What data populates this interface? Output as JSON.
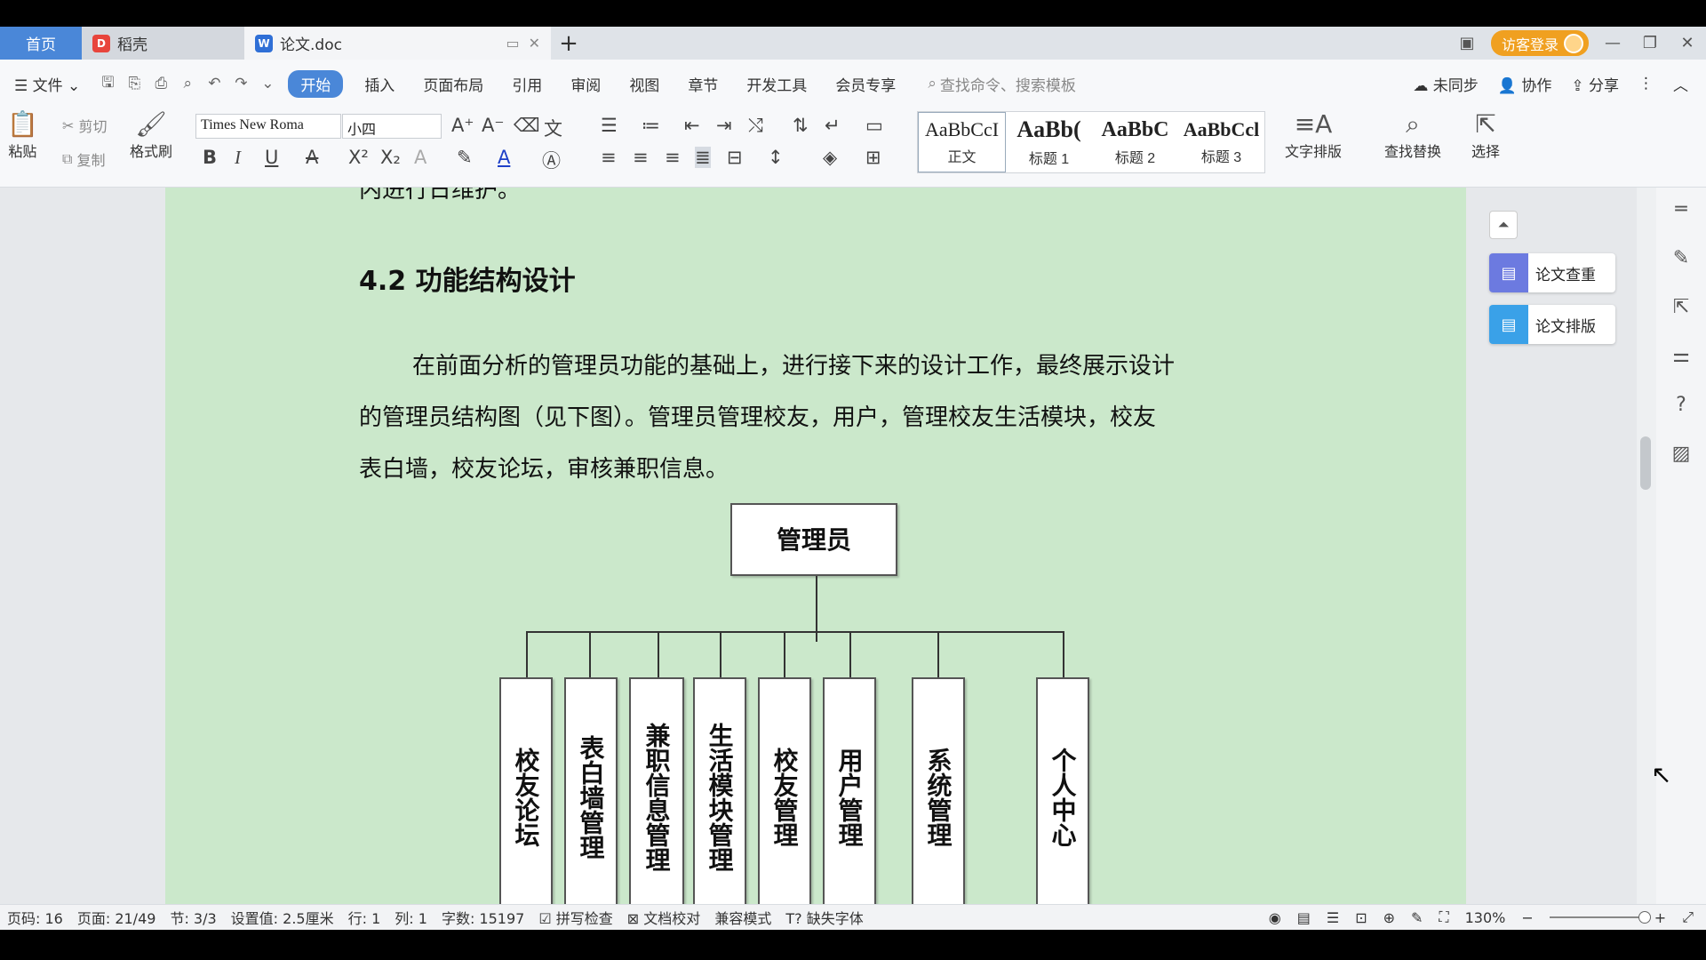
{
  "tabs": {
    "home": "首页",
    "straw": "稻壳",
    "doc": "论文.doc",
    "add": "+"
  },
  "titlebar": {
    "login": "访客登录"
  },
  "menu": {
    "file": "文件",
    "items": [
      "开始",
      "插入",
      "页面布局",
      "引用",
      "审阅",
      "视图",
      "章节",
      "开发工具",
      "会员专享"
    ],
    "search_placeholder": "查找命令、搜索模板",
    "unsynced": "未同步",
    "collab": "协作",
    "share": "分享"
  },
  "ribbon": {
    "paste": "粘贴",
    "cut": "剪切",
    "copy": "复制",
    "format_painter": "格式刷",
    "font_name": "Times New Roma",
    "font_size": "小四",
    "styles": [
      {
        "preview": "AaBbCcI",
        "name": "正文"
      },
      {
        "preview": "AaBb(",
        "name": "标题 1"
      },
      {
        "preview": "AaBbC",
        "name": "标题 2"
      },
      {
        "preview": "AaBbCcl",
        "name": "标题 3"
      }
    ],
    "text_layout": "文字排版",
    "find_replace": "查找替换",
    "select": "选择"
  },
  "document": {
    "partial_top": "内进行日维护。",
    "heading": "4.2  功能结构设计",
    "para_line1": "在前面分析的管理员功能的基础上，进行接下来的设计工作，最终展示设计",
    "para_line2": "的管理员结构图（见下图）。管理员管理校友，用户，管理校友生活模块，校友",
    "para_line3": "表白墙，校友论坛，审核兼职信息。",
    "diagram": {
      "root": "管理员",
      "children": [
        "校友论坛",
        "表白墙管理",
        "兼职信息管理",
        "生活模块管理",
        "校友管理",
        "用户管理",
        "系统管理",
        "个人中心"
      ]
    }
  },
  "right_panel": {
    "paper_check": "论文查重",
    "paper_format": "论文排版"
  },
  "status": {
    "page_code": "页码: 16",
    "page": "页面: 21/49",
    "section": "节: 3/3",
    "setting": "设置值: 2.5厘米",
    "row": "行: 1",
    "col": "列: 1",
    "words": "字数: 15197",
    "spell": "拼写检查",
    "doc_check": "文档校对",
    "compat": "兼容模式",
    "missing_font": "缺失字体",
    "zoom": "130%"
  }
}
